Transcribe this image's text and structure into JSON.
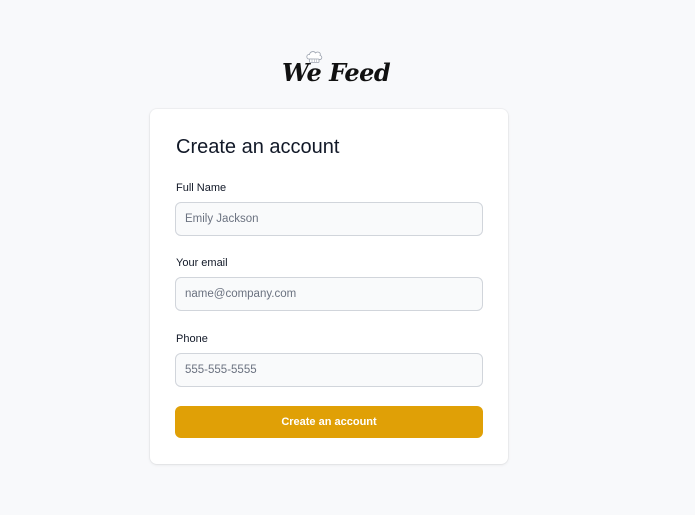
{
  "brand": {
    "name": "We Feed",
    "logo_icon": "chef-hat-icon"
  },
  "form": {
    "title": "Create an account",
    "fields": [
      {
        "label": "Full Name",
        "placeholder": "Emily Jackson",
        "value": ""
      },
      {
        "label": "Your email",
        "placeholder": "name@company.com",
        "value": ""
      },
      {
        "label": "Phone",
        "placeholder": "555-555-5555",
        "value": ""
      }
    ],
    "submit_label": "Create an account"
  },
  "colors": {
    "background": "#f8f9fb",
    "card": "#ffffff",
    "accent": "#e0a006",
    "input_bg": "#f9fafb",
    "input_border": "#d1d5db"
  }
}
